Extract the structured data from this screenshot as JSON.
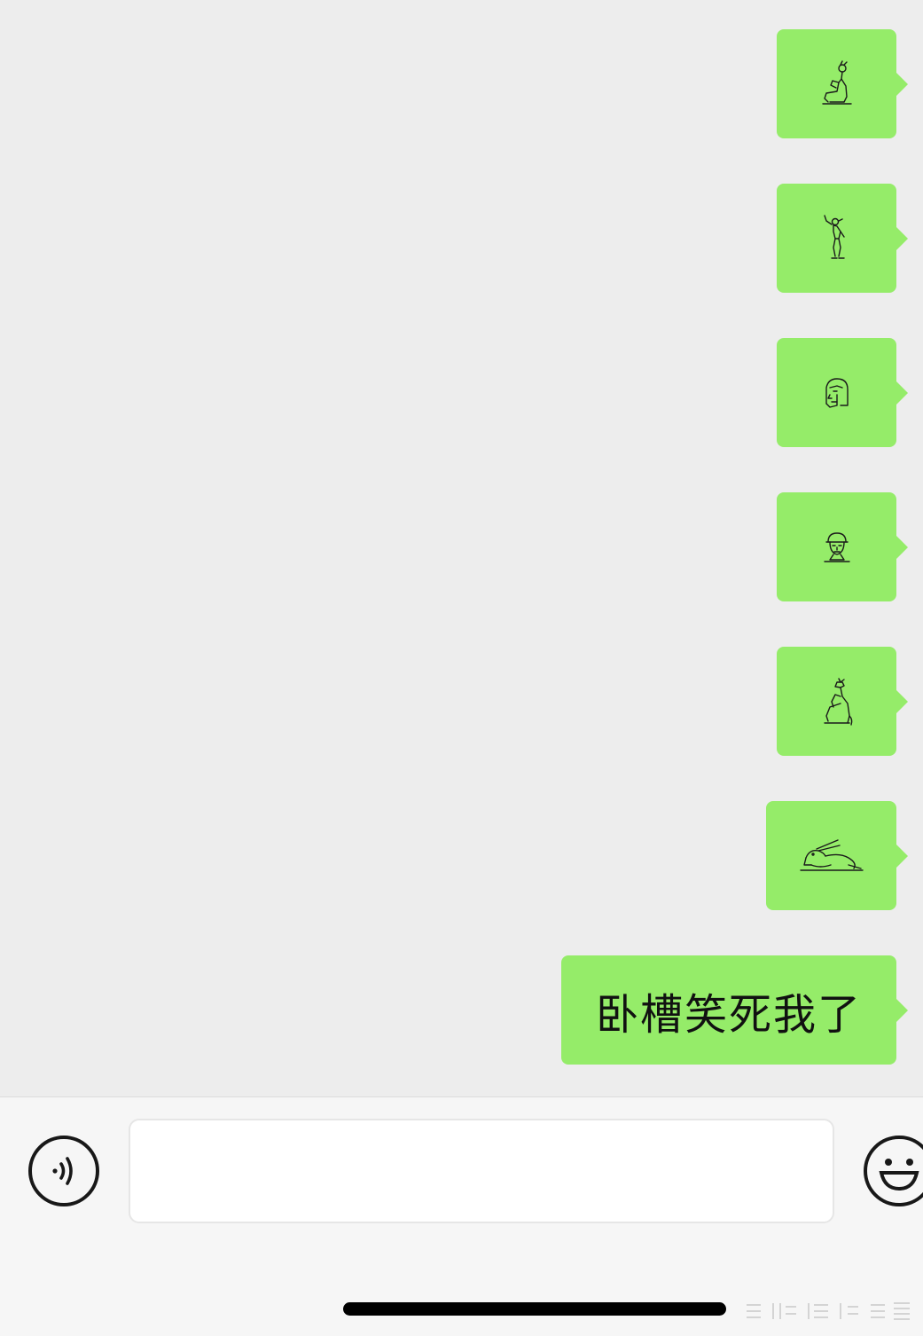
{
  "messages": [
    {
      "type": "glyph",
      "icon": "hieroglyph-seated-god-icon"
    },
    {
      "type": "glyph",
      "icon": "hieroglyph-standing-figure-icon"
    },
    {
      "type": "glyph",
      "icon": "hieroglyph-pharaoh-head-icon"
    },
    {
      "type": "glyph",
      "icon": "hieroglyph-face-icon"
    },
    {
      "type": "glyph",
      "icon": "hieroglyph-seated-animal-god-icon"
    },
    {
      "type": "glyph",
      "icon": "hieroglyph-hare-icon"
    },
    {
      "type": "text",
      "text": "卧槽笑死我了"
    }
  ],
  "input_bar": {
    "voice_icon": "voice-icon",
    "input_value": "",
    "emoji_icon": "emoji-icon"
  },
  "colors": {
    "background": "#ededed",
    "sent_bubble": "#95ec69",
    "input_bar": "#f6f6f6"
  }
}
